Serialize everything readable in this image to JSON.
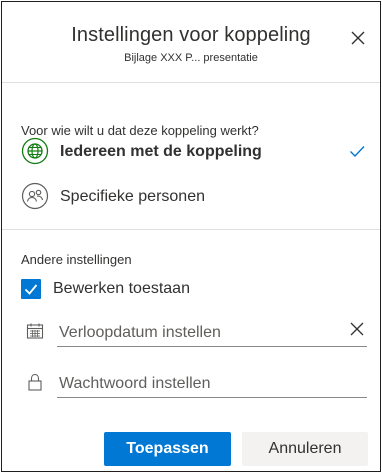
{
  "dialog": {
    "title": "Instellingen voor koppeling",
    "subtitle": "Bijlage XXX P... presentatie",
    "close_icon": "close-icon"
  },
  "audience": {
    "question": "Voor wie wilt u dat deze koppeling werkt?",
    "options": [
      {
        "label": "Iedereen met de koppeling",
        "icon": "globe-icon",
        "selected": true
      },
      {
        "label": "Specifieke personen",
        "icon": "people-icon",
        "selected": false
      }
    ]
  },
  "other_settings": {
    "label": "Andere instellingen",
    "allow_edit": {
      "label": "Bewerken toestaan",
      "checked": true
    },
    "expiry": {
      "placeholder": "Verloopdatum instellen",
      "value": "",
      "icon": "calendar-icon"
    },
    "password": {
      "placeholder": "Wachtwoord instellen",
      "value": "",
      "icon": "lock-icon"
    }
  },
  "actions": {
    "apply": "Toepassen",
    "cancel": "Annuleren"
  },
  "colors": {
    "accent": "#0078d4",
    "text": "#323130",
    "secondary_button": "#f3f2f1"
  }
}
